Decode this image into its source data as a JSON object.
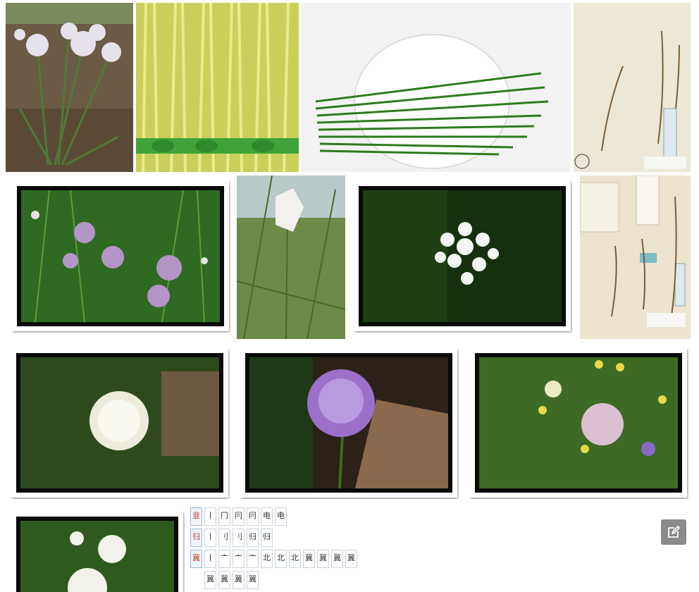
{
  "gallery": {
    "images": [
      {
        "subject": "onion plant in garden soil"
      },
      {
        "subject": "bundled yellow chive sprouts"
      },
      {
        "subject": "green garlic chive stems on white plate"
      },
      {
        "subject": "herbarium specimen sheet"
      },
      {
        "subject": "purple allium flowers in grass"
      },
      {
        "subject": "white flower bud on stalk"
      },
      {
        "subject": "white star allium umbel"
      },
      {
        "subject": "herbarium specimen sheet with labels"
      },
      {
        "subject": "white allium flower head"
      },
      {
        "subject": "purple allium flower head"
      },
      {
        "subject": "pink allium flower in meadow"
      },
      {
        "subject": "white allium flowers in garden"
      },
      {
        "subject": "stroke order chart"
      }
    ]
  },
  "stroke_chart": {
    "rows": [
      [
        "韭",
        "丨",
        "冂",
        "冃",
        "冃",
        "电",
        "电"
      ],
      [
        "归",
        "丨",
        "刂",
        "刂",
        "归",
        "归"
      ],
      [
        "冀",
        "丨",
        "亠",
        "亠",
        "亠",
        "北",
        "北",
        "北",
        "冀",
        "冀",
        "冀",
        "冀"
      ],
      [
        "冀",
        "冀",
        "冀",
        "冀"
      ]
    ]
  },
  "edit_button": {
    "icon": "edit-icon",
    "color": "#8b8b8b"
  }
}
